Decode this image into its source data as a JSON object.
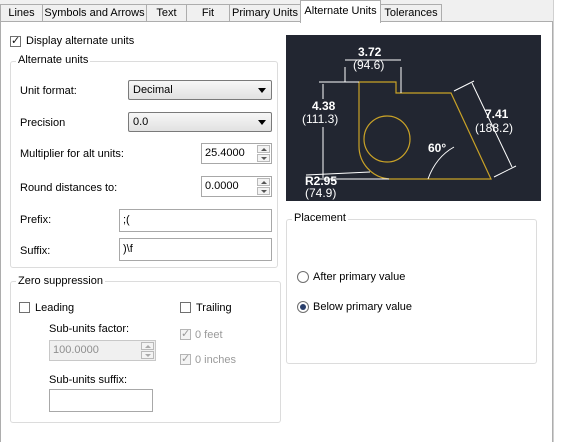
{
  "tabs": [
    {
      "label": "Lines"
    },
    {
      "label": "Symbols and Arrows"
    },
    {
      "label": "Text"
    },
    {
      "label": "Fit"
    },
    {
      "label": "Primary Units"
    },
    {
      "label": "Alternate Units"
    },
    {
      "label": "Tolerances"
    }
  ],
  "display_alt_units": {
    "label": "Display alternate units",
    "checked": true
  },
  "alternate_units": {
    "title": "Alternate units",
    "unit_format": {
      "label": "Unit format:",
      "value": "Decimal"
    },
    "precision": {
      "label": "Precision",
      "value": "0.0"
    },
    "multiplier": {
      "label": "Multiplier for alt units:",
      "value": "25.4000"
    },
    "round": {
      "label": "Round distances to:",
      "value": "0.0000"
    },
    "prefix": {
      "label": "Prefix:",
      "value": ";("
    },
    "suffix": {
      "label": "Suffix:",
      "value": ")\\f"
    }
  },
  "zero_suppression": {
    "title": "Zero suppression",
    "leading": {
      "label": "Leading",
      "checked": false
    },
    "trailing": {
      "label": "Trailing",
      "checked": false
    },
    "sub_units_factor": {
      "label": "Sub-units factor:",
      "value": "100.0000"
    },
    "sub_units_suffix": {
      "label": "Sub-units suffix:",
      "value": ""
    },
    "zero_feet": {
      "label": "0 feet",
      "checked": true
    },
    "zero_inches": {
      "label": "0 inches",
      "checked": true
    }
  },
  "placement": {
    "title": "Placement",
    "after": {
      "label": "After primary value",
      "selected": false
    },
    "below": {
      "label": "Below primary value",
      "selected": true
    }
  },
  "preview": {
    "dim_top": "3.72",
    "dim_top_alt": "(94.6)",
    "dim_left": "4.38",
    "dim_left_alt": "(111.3)",
    "dim_right": "7.41",
    "dim_right_alt": "(188.2)",
    "angle": "60°",
    "radius": "R2.95",
    "radius_alt": "(74.9)",
    "colors": {
      "background": "#222631",
      "outline": "#c9a227",
      "dims": "#ffffff"
    }
  }
}
